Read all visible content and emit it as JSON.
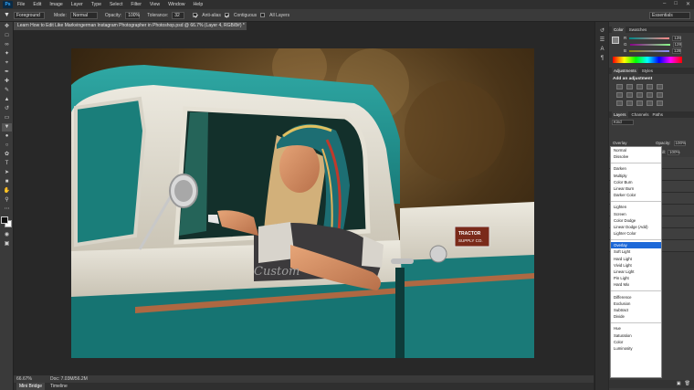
{
  "app": {
    "logo": "Ps"
  },
  "menu": [
    "File",
    "Edit",
    "Image",
    "Layer",
    "Type",
    "Select",
    "Filter",
    "View",
    "Window",
    "Help"
  ],
  "window_controls": [
    "–",
    "□",
    "✕"
  ],
  "options": {
    "source": "Foreground",
    "mode_label": "Mode:",
    "mode_value": "Normal",
    "opacity_label": "Opacity:",
    "opacity_value": "100%",
    "tolerance_label": "Tolerance:",
    "tolerance_value": "32",
    "anti_alias": "Anti-alias",
    "contiguous": "Contiguous",
    "all_layers": "All Layers",
    "workspace": "Essentials"
  },
  "document": {
    "tab_title": "Learn How to Edit Like Markvingerman Instagram Photographer in Photoshop.psd @ 66.7% (Layer 4, RGB/8#) *",
    "zoom": "66.67%",
    "doc_size": "Doc: 7.03M/56.2M"
  },
  "bottom_tabs": [
    "Mini Bridge",
    "Timeline"
  ],
  "color_panel": {
    "tabs": [
      "Color",
      "Swatches"
    ],
    "rows": [
      {
        "label": "R",
        "value": "128",
        "color": "#e04848"
      },
      {
        "label": "G",
        "value": "128",
        "color": "#48c048"
      },
      {
        "label": "B",
        "value": "128",
        "color": "#4878e0"
      }
    ]
  },
  "adjustments_panel": {
    "tabs": [
      "Adjustments",
      "Styles"
    ],
    "heading": "Add an adjustment"
  },
  "layers_panel": {
    "tabs": [
      "Layers",
      "Channels",
      "Paths"
    ],
    "kind_filter": "Kind",
    "blend_mode": "Overlay",
    "opacity_label": "Opacity:",
    "opacity_value": "100%",
    "fill_label": "Fill:",
    "fill_value": "100%"
  },
  "blend_menu": {
    "groups": [
      [
        "Normal",
        "Dissolve"
      ],
      [
        "Darken",
        "Multiply",
        "Color Burn",
        "Linear Burn",
        "Darker Color"
      ],
      [
        "Lighten",
        "Screen",
        "Color Dodge",
        "Linear Dodge (Add)",
        "Lighter Color"
      ],
      [
        "Overlay",
        "Soft Light",
        "Hard Light",
        "Vivid Light",
        "Linear Light",
        "Pin Light",
        "Hard Mix"
      ],
      [
        "Difference",
        "Exclusion",
        "Subtract",
        "Divide"
      ],
      [
        "Hue",
        "Saturation",
        "Color",
        "Luminosity"
      ]
    ],
    "selected": "Overlay"
  },
  "photo": {
    "truck_brand_plate_line1": "TRACTOR",
    "truck_brand_plate_line2": "SUPPLY CO.",
    "truck_script": "Custom"
  }
}
